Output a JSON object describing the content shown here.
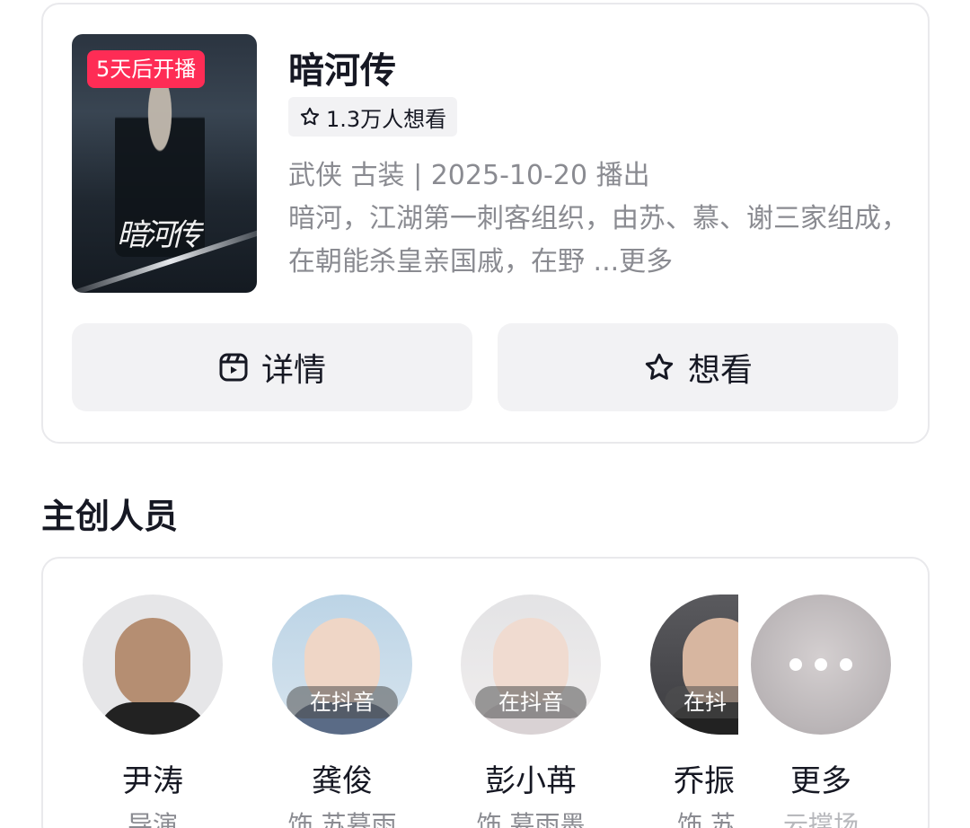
{
  "show": {
    "badge": "5天后开播",
    "title": "暗河传",
    "want_count": "1.3万人想看",
    "meta": "武侠 古装 | 2025-10-20 播出",
    "description": "暗河，江湖第一刺客组织，由苏、慕、谢三家组成，在朝能杀皇亲国戚，在野 ...",
    "more_label": "更多",
    "poster_title": "暗河传"
  },
  "buttons": {
    "detail_label": "详情",
    "want_label": "想看"
  },
  "section": {
    "title": "主创人员"
  },
  "cast": [
    {
      "name": "尹涛",
      "role": "导演",
      "live_tag": ""
    },
    {
      "name": "龚俊",
      "role": "饰 苏暮雨",
      "live_tag": "在抖音"
    },
    {
      "name": "彭小苒",
      "role": "饰 慕雨墨",
      "live_tag": "在抖音"
    },
    {
      "name": "乔振",
      "role": "饰 苏",
      "live_tag": "在抖"
    }
  ],
  "more_cast": {
    "name": "更多",
    "role": "云撑场"
  },
  "colors": {
    "badge": "#fe2c55",
    "text_primary": "#161823",
    "text_secondary": "#8a8b91",
    "button_bg": "#f2f2f4"
  },
  "icons": {
    "want_chip": "star-outline-icon",
    "detail_button": "video-frame-icon",
    "want_button": "star-outline-icon",
    "more": "ellipsis-icon"
  }
}
